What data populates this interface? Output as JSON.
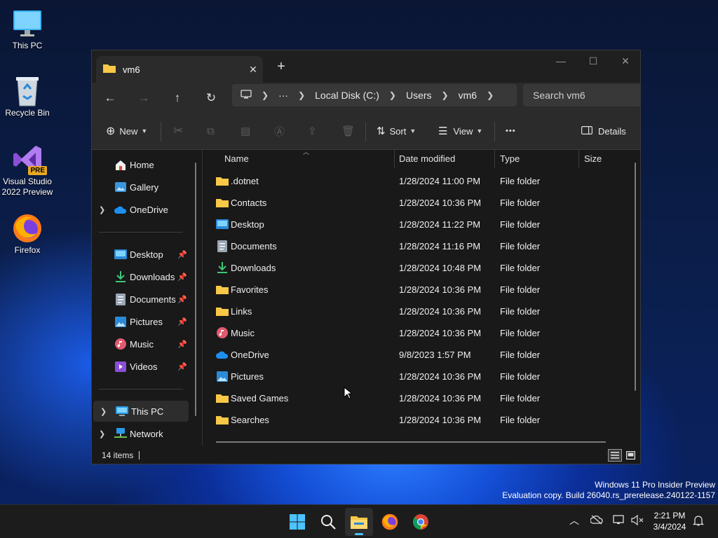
{
  "desktop": {
    "icons": [
      {
        "label": "This PC",
        "icon": "monitor-icon"
      },
      {
        "label": "Recycle Bin",
        "icon": "recycle-bin-icon"
      },
      {
        "label": "Visual Studio 2022 Preview",
        "icon": "visual-studio-icon",
        "badge": "PRE"
      },
      {
        "label": "Firefox",
        "icon": "firefox-icon"
      }
    ]
  },
  "window": {
    "tab_title": "vm6",
    "new_tab": "+",
    "controls": {
      "minimize": "—",
      "maximize": "☐",
      "close": "✕"
    },
    "nav": {
      "back": "←",
      "forward": "→",
      "up": "↑",
      "refresh": "↻"
    },
    "address": {
      "ellipsis": "···",
      "segments": [
        "Local Disk (C:)",
        "Users",
        "vm6"
      ]
    },
    "search_placeholder": "Search vm6",
    "commands": {
      "new": "New",
      "sort": "Sort",
      "view": "View",
      "more": "•••",
      "details": "Details"
    },
    "nav_pane": {
      "top": [
        {
          "label": "Home",
          "icon": "home-icon",
          "expandable": false
        },
        {
          "label": "Gallery",
          "icon": "gallery-icon",
          "expandable": false
        },
        {
          "label": "OneDrive",
          "icon": "onedrive-icon",
          "expandable": true
        }
      ],
      "quick_access": [
        {
          "label": "Desktop",
          "icon": "desktop-folder-icon"
        },
        {
          "label": "Downloads",
          "icon": "downloads-icon"
        },
        {
          "label": "Documents",
          "icon": "documents-icon"
        },
        {
          "label": "Pictures",
          "icon": "pictures-icon"
        },
        {
          "label": "Music",
          "icon": "music-icon"
        },
        {
          "label": "Videos",
          "icon": "videos-icon"
        }
      ],
      "bottom": [
        {
          "label": "This PC",
          "icon": "this-pc-icon",
          "selected": true
        },
        {
          "label": "Network",
          "icon": "network-icon",
          "selected": false
        }
      ]
    },
    "columns": {
      "name": "Name",
      "date": "Date modified",
      "type": "Type",
      "size": "Size"
    },
    "files": [
      {
        "name": ".dotnet",
        "date": "1/28/2024 11:00 PM",
        "type": "File folder",
        "icon": "folder-icon"
      },
      {
        "name": "Contacts",
        "date": "1/28/2024 10:36 PM",
        "type": "File folder",
        "icon": "folder-icon"
      },
      {
        "name": "Desktop",
        "date": "1/28/2024 11:22 PM",
        "type": "File folder",
        "icon": "desktop-folder-icon"
      },
      {
        "name": "Documents",
        "date": "1/28/2024 11:16 PM",
        "type": "File folder",
        "icon": "documents-icon"
      },
      {
        "name": "Downloads",
        "date": "1/28/2024 10:48 PM",
        "type": "File folder",
        "icon": "downloads-icon"
      },
      {
        "name": "Favorites",
        "date": "1/28/2024 10:36 PM",
        "type": "File folder",
        "icon": "folder-icon"
      },
      {
        "name": "Links",
        "date": "1/28/2024 10:36 PM",
        "type": "File folder",
        "icon": "folder-icon"
      },
      {
        "name": "Music",
        "date": "1/28/2024 10:36 PM",
        "type": "File folder",
        "icon": "music-icon"
      },
      {
        "name": "OneDrive",
        "date": "9/8/2023 1:57 PM",
        "type": "File folder",
        "icon": "onedrive-icon"
      },
      {
        "name": "Pictures",
        "date": "1/28/2024 10:36 PM",
        "type": "File folder",
        "icon": "pictures-icon"
      },
      {
        "name": "Saved Games",
        "date": "1/28/2024 10:36 PM",
        "type": "File folder",
        "icon": "folder-icon"
      },
      {
        "name": "Searches",
        "date": "1/28/2024 10:36 PM",
        "type": "File folder",
        "icon": "folder-icon"
      }
    ],
    "status": "14 items"
  },
  "watermark": {
    "line1": "Windows 11 Pro Insider Preview",
    "line2": "Evaluation copy. Build 26040.rs_prerelease.240122-1157"
  },
  "taskbar": {
    "apps": [
      "start-icon",
      "search-icon",
      "file-explorer-icon",
      "firefox-icon",
      "chrome-icon"
    ],
    "clock": {
      "time": "2:21 PM",
      "date": "3/4/2024"
    }
  },
  "colors": {
    "folder": "#f8c846",
    "accent": "#4cc2ff",
    "window_bg": "#191919",
    "toolbar_bg": "#2b2b2b"
  }
}
